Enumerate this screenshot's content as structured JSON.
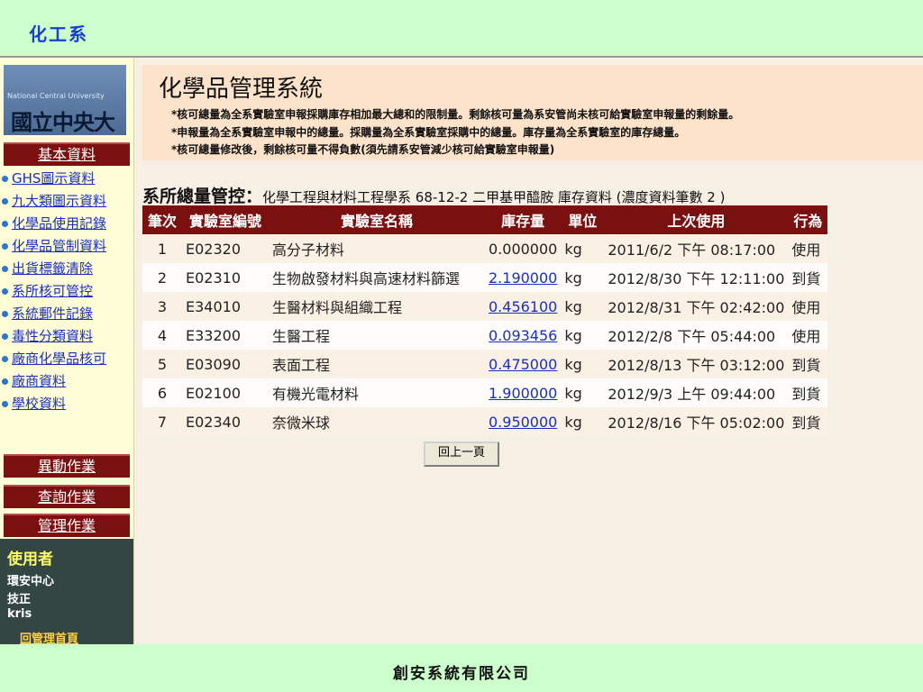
{
  "header": {
    "dept": "化工系"
  },
  "sidebar": {
    "logo_en": "National Central University",
    "logo_cn": "國立中央大學",
    "section_basic": "基本資料",
    "items": [
      {
        "label": "GHS圖示資料"
      },
      {
        "label": "九大類圖示資料"
      },
      {
        "label": "化學品使用記錄"
      },
      {
        "label": "化學品管制資料"
      },
      {
        "label": "出貨標籤清除"
      },
      {
        "label": "系所核可管控"
      },
      {
        "label": "系統郵件記錄"
      },
      {
        "label": "毒性分類資料"
      },
      {
        "label": "廠商化學品核可"
      },
      {
        "label": "廠商資料"
      },
      {
        "label": "學校資料"
      }
    ],
    "section_change": "異動作業",
    "section_query": "查詢作業",
    "section_admin": "管理作業",
    "user": {
      "heading": "使用者",
      "unit": "環安中心",
      "role": "技正",
      "name": "kris",
      "home_link": "回管理首頁"
    }
  },
  "main": {
    "title": "化學品管理系統",
    "notes": [
      "*核可總量為全系實驗室申報採購庫存相加最大總和的限制量。剩餘核可量為系安管尚未核可給實驗室申報量的剩餘量。",
      "*申報量為全系實驗室申報中的總量。採購量為全系實驗室採購中的總量。庫存量為全系實驗室的庫存總量。",
      "*核可總量修改後，剩餘核可量不得負數(須先請系安管減少核可給實驗室申報量)"
    ],
    "subtitle_lead": "系所總量管控：",
    "subtitle_detail": "化學工程與材料工程學系  68-12-2  二甲基甲醯胺 庫存資料 (濃度資料筆數 2 )",
    "table": {
      "headers": [
        "筆次",
        "實驗室編號",
        "實驗室名稱",
        "庫存量",
        "單位",
        "上次使用",
        "行為"
      ],
      "rows": [
        {
          "no": "1",
          "lab_id": "E02320",
          "lab_name": "高分子材料",
          "qty": "0.000000",
          "unit": "kg",
          "last_used": "2011/6/2 下午 08:17:00",
          "action": "使用"
        },
        {
          "no": "2",
          "lab_id": "E02310",
          "lab_name": "生物啟發材料與高速材料篩選",
          "qty": "2.190000",
          "unit": "kg",
          "last_used": "2012/8/30 下午 12:11:00",
          "action": "到貨"
        },
        {
          "no": "3",
          "lab_id": "E34010",
          "lab_name": "生醫材料與組織工程",
          "qty": "0.456100",
          "unit": "kg",
          "last_used": "2012/8/31 下午 02:42:00",
          "action": "使用"
        },
        {
          "no": "4",
          "lab_id": "E33200",
          "lab_name": "生醫工程",
          "qty": "0.093456",
          "unit": "kg",
          "last_used": "2012/2/8 下午 05:44:00",
          "action": "使用"
        },
        {
          "no": "5",
          "lab_id": "E03090",
          "lab_name": "表面工程",
          "qty": "0.475000",
          "unit": "kg",
          "last_used": "2012/8/13 下午 03:12:00",
          "action": "到貨"
        },
        {
          "no": "6",
          "lab_id": "E02100",
          "lab_name": "有機光電材料",
          "qty": "1.900000",
          "unit": "kg",
          "last_used": "2012/9/3 上午 09:44:00",
          "action": "到貨"
        },
        {
          "no": "7",
          "lab_id": "E02340",
          "lab_name": "奈微米球",
          "qty": "0.950000",
          "unit": "kg",
          "last_used": "2012/8/16 下午 05:02:00",
          "action": "到貨"
        }
      ]
    },
    "back_button": "回上一頁"
  },
  "footer": {
    "company": "創安系統有限公司"
  }
}
